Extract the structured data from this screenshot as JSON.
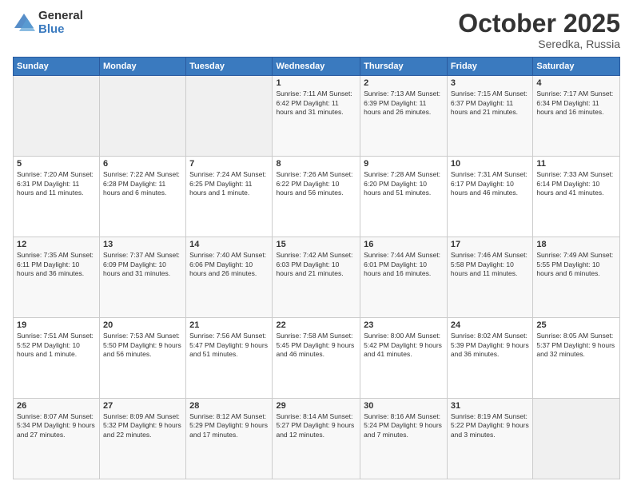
{
  "logo": {
    "general": "General",
    "blue": "Blue"
  },
  "header": {
    "month": "October 2025",
    "location": "Seredka, Russia"
  },
  "weekdays": [
    "Sunday",
    "Monday",
    "Tuesday",
    "Wednesday",
    "Thursday",
    "Friday",
    "Saturday"
  ],
  "weeks": [
    [
      {
        "day": "",
        "info": ""
      },
      {
        "day": "",
        "info": ""
      },
      {
        "day": "",
        "info": ""
      },
      {
        "day": "1",
        "info": "Sunrise: 7:11 AM\nSunset: 6:42 PM\nDaylight: 11 hours\nand 31 minutes."
      },
      {
        "day": "2",
        "info": "Sunrise: 7:13 AM\nSunset: 6:39 PM\nDaylight: 11 hours\nand 26 minutes."
      },
      {
        "day": "3",
        "info": "Sunrise: 7:15 AM\nSunset: 6:37 PM\nDaylight: 11 hours\nand 21 minutes."
      },
      {
        "day": "4",
        "info": "Sunrise: 7:17 AM\nSunset: 6:34 PM\nDaylight: 11 hours\nand 16 minutes."
      }
    ],
    [
      {
        "day": "5",
        "info": "Sunrise: 7:20 AM\nSunset: 6:31 PM\nDaylight: 11 hours\nand 11 minutes."
      },
      {
        "day": "6",
        "info": "Sunrise: 7:22 AM\nSunset: 6:28 PM\nDaylight: 11 hours\nand 6 minutes."
      },
      {
        "day": "7",
        "info": "Sunrise: 7:24 AM\nSunset: 6:25 PM\nDaylight: 11 hours\nand 1 minute."
      },
      {
        "day": "8",
        "info": "Sunrise: 7:26 AM\nSunset: 6:22 PM\nDaylight: 10 hours\nand 56 minutes."
      },
      {
        "day": "9",
        "info": "Sunrise: 7:28 AM\nSunset: 6:20 PM\nDaylight: 10 hours\nand 51 minutes."
      },
      {
        "day": "10",
        "info": "Sunrise: 7:31 AM\nSunset: 6:17 PM\nDaylight: 10 hours\nand 46 minutes."
      },
      {
        "day": "11",
        "info": "Sunrise: 7:33 AM\nSunset: 6:14 PM\nDaylight: 10 hours\nand 41 minutes."
      }
    ],
    [
      {
        "day": "12",
        "info": "Sunrise: 7:35 AM\nSunset: 6:11 PM\nDaylight: 10 hours\nand 36 minutes."
      },
      {
        "day": "13",
        "info": "Sunrise: 7:37 AM\nSunset: 6:09 PM\nDaylight: 10 hours\nand 31 minutes."
      },
      {
        "day": "14",
        "info": "Sunrise: 7:40 AM\nSunset: 6:06 PM\nDaylight: 10 hours\nand 26 minutes."
      },
      {
        "day": "15",
        "info": "Sunrise: 7:42 AM\nSunset: 6:03 PM\nDaylight: 10 hours\nand 21 minutes."
      },
      {
        "day": "16",
        "info": "Sunrise: 7:44 AM\nSunset: 6:01 PM\nDaylight: 10 hours\nand 16 minutes."
      },
      {
        "day": "17",
        "info": "Sunrise: 7:46 AM\nSunset: 5:58 PM\nDaylight: 10 hours\nand 11 minutes."
      },
      {
        "day": "18",
        "info": "Sunrise: 7:49 AM\nSunset: 5:55 PM\nDaylight: 10 hours\nand 6 minutes."
      }
    ],
    [
      {
        "day": "19",
        "info": "Sunrise: 7:51 AM\nSunset: 5:52 PM\nDaylight: 10 hours\nand 1 minute."
      },
      {
        "day": "20",
        "info": "Sunrise: 7:53 AM\nSunset: 5:50 PM\nDaylight: 9 hours\nand 56 minutes."
      },
      {
        "day": "21",
        "info": "Sunrise: 7:56 AM\nSunset: 5:47 PM\nDaylight: 9 hours\nand 51 minutes."
      },
      {
        "day": "22",
        "info": "Sunrise: 7:58 AM\nSunset: 5:45 PM\nDaylight: 9 hours\nand 46 minutes."
      },
      {
        "day": "23",
        "info": "Sunrise: 8:00 AM\nSunset: 5:42 PM\nDaylight: 9 hours\nand 41 minutes."
      },
      {
        "day": "24",
        "info": "Sunrise: 8:02 AM\nSunset: 5:39 PM\nDaylight: 9 hours\nand 36 minutes."
      },
      {
        "day": "25",
        "info": "Sunrise: 8:05 AM\nSunset: 5:37 PM\nDaylight: 9 hours\nand 32 minutes."
      }
    ],
    [
      {
        "day": "26",
        "info": "Sunrise: 8:07 AM\nSunset: 5:34 PM\nDaylight: 9 hours\nand 27 minutes."
      },
      {
        "day": "27",
        "info": "Sunrise: 8:09 AM\nSunset: 5:32 PM\nDaylight: 9 hours\nand 22 minutes."
      },
      {
        "day": "28",
        "info": "Sunrise: 8:12 AM\nSunset: 5:29 PM\nDaylight: 9 hours\nand 17 minutes."
      },
      {
        "day": "29",
        "info": "Sunrise: 8:14 AM\nSunset: 5:27 PM\nDaylight: 9 hours\nand 12 minutes."
      },
      {
        "day": "30",
        "info": "Sunrise: 8:16 AM\nSunset: 5:24 PM\nDaylight: 9 hours\nand 7 minutes."
      },
      {
        "day": "31",
        "info": "Sunrise: 8:19 AM\nSunset: 5:22 PM\nDaylight: 9 hours\nand 3 minutes."
      },
      {
        "day": "",
        "info": ""
      }
    ]
  ]
}
